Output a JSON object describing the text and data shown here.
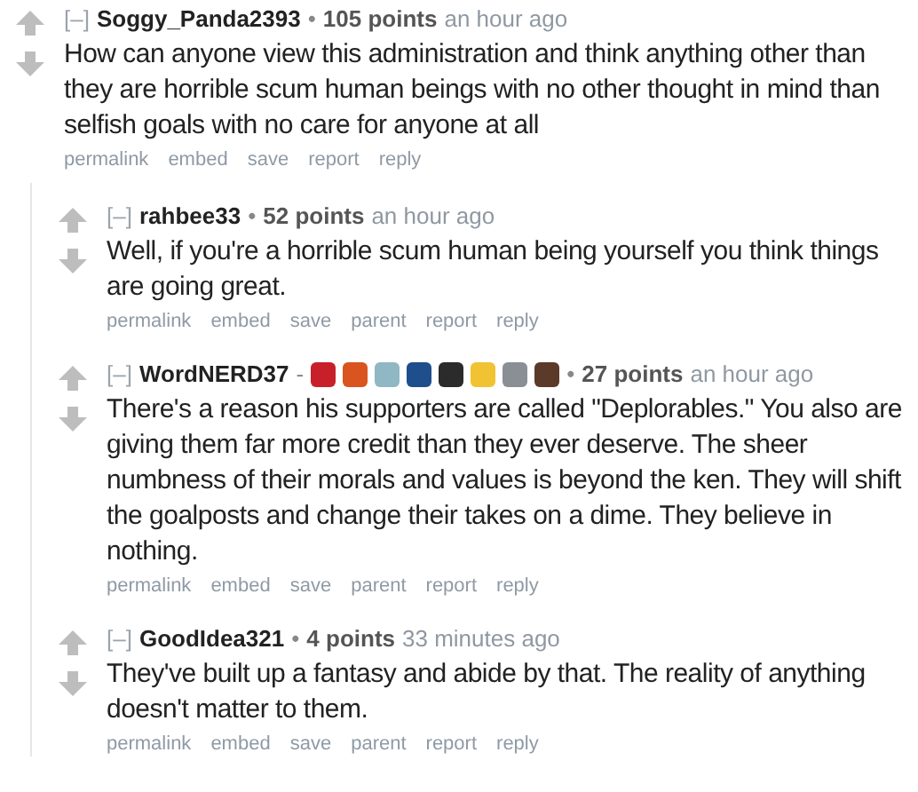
{
  "comments": [
    {
      "collapse": "[–]",
      "author": "Soggy_Panda2393",
      "bullet": "•",
      "points": "105 points",
      "time": "an hour ago",
      "body": "How can anyone view this administration and think anything other than they are horrible scum human beings with no other thought in mind than selfish goals with no care for anyone at all",
      "links": [
        "permalink",
        "embed",
        "save",
        "report",
        "reply"
      ],
      "children": [
        {
          "collapse": "[–]",
          "author": "rahbee33",
          "bullet": "•",
          "points": "52 points",
          "time": "an hour ago",
          "body": "Well, if you're a horrible scum human being yourself you think things are going great.",
          "links": [
            "permalink",
            "embed",
            "save",
            "parent",
            "report",
            "reply"
          ]
        },
        {
          "collapse": "[–]",
          "author": "WordNERD37",
          "dash": "-",
          "flairs": [
            {
              "color": "#c8202a"
            },
            {
              "color": "#d9541e"
            },
            {
              "color": "#8fb7c4"
            },
            {
              "color": "#1e4f8c"
            },
            {
              "color": "#2b2b2b"
            },
            {
              "color": "#f1c232"
            },
            {
              "color": "#8a8f96"
            },
            {
              "color": "#5b3a2a"
            }
          ],
          "bullet": "•",
          "points": "27 points",
          "time": "an hour ago",
          "body": "There's a reason his supporters are called \"Deplorables.\" You also are giving them far more credit than they ever deserve. The sheer numbness of their morals and values is beyond the ken. They will shift the goalposts and change their takes on a dime. They believe in nothing.",
          "links": [
            "permalink",
            "embed",
            "save",
            "parent",
            "report",
            "reply"
          ]
        },
        {
          "collapse": "[–]",
          "author": "GoodIdea321",
          "bullet": "•",
          "points": "4 points",
          "time": "33 minutes ago",
          "body": "They've built up a fantasy and abide by that. The reality of anything doesn't matter to them.",
          "links": [
            "permalink",
            "embed",
            "save",
            "parent",
            "report",
            "reply"
          ]
        }
      ]
    }
  ]
}
